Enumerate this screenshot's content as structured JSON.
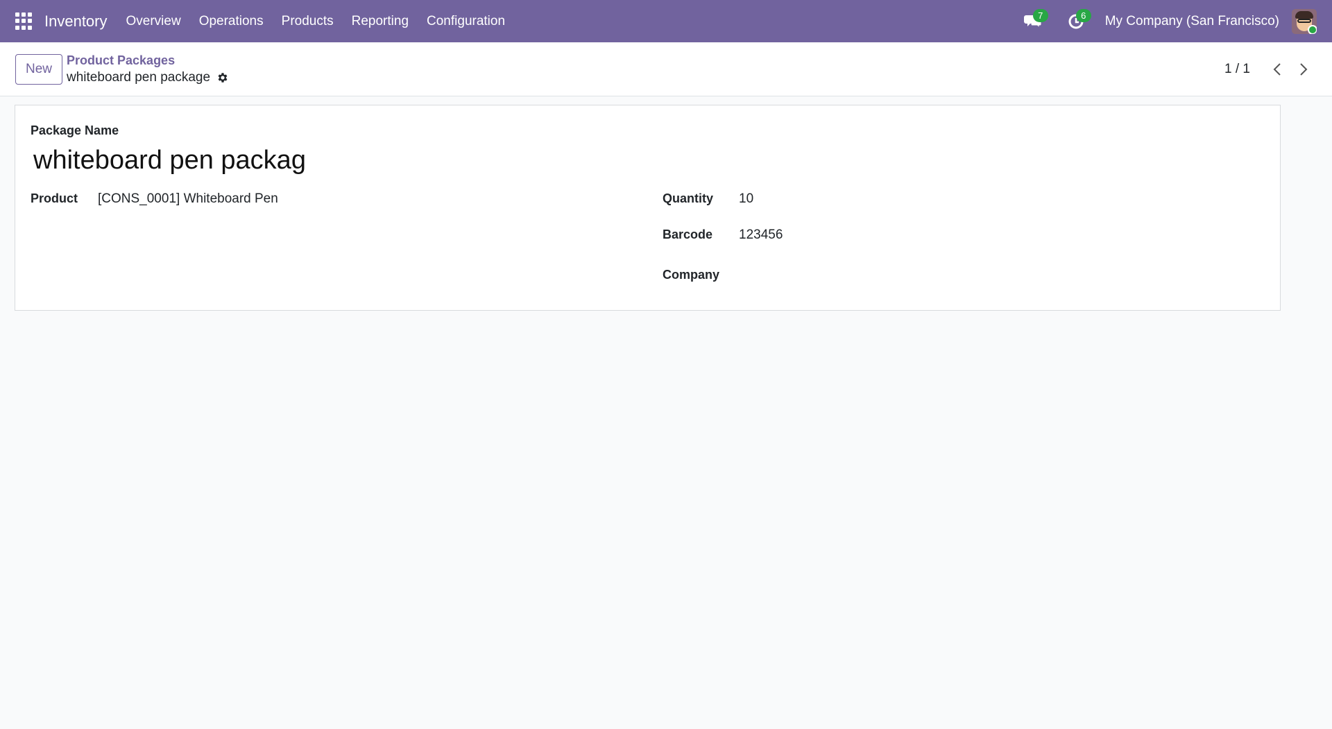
{
  "navbar": {
    "brand": "Inventory",
    "menu": [
      "Overview",
      "Operations",
      "Products",
      "Reporting",
      "Configuration"
    ],
    "messages_count": "7",
    "activities_count": "6",
    "company": "My Company (San Francisco)"
  },
  "control_panel": {
    "new_label": "New",
    "breadcrumb_parent": "Product Packages",
    "breadcrumb_current": "whiteboard pen package",
    "pager": "1 / 1"
  },
  "form": {
    "name_label": "Package Name",
    "name_value": "whiteboard pen package",
    "product_label": "Product",
    "product_value": "[CONS_0001] Whiteboard Pen",
    "quantity_label": "Quantity",
    "quantity_value": "10",
    "barcode_label": "Barcode",
    "barcode_value": "123456",
    "company_label": "Company",
    "company_value": ""
  },
  "colors": {
    "brand": "#71639e",
    "badge": "#28a745"
  }
}
